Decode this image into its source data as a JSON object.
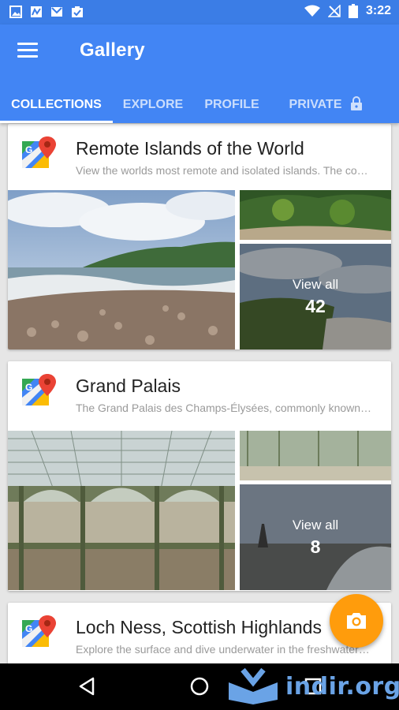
{
  "status_bar": {
    "time": "3:22",
    "left_icons": [
      "image-icon",
      "newsstand-icon",
      "gmail-icon",
      "task-icon"
    ],
    "right_icons": [
      "wifi-icon",
      "no-signal-icon",
      "battery-icon"
    ]
  },
  "app_bar": {
    "title": "Gallery",
    "menu_icon": "hamburger-menu-icon",
    "tabs": [
      {
        "label": "COLLECTIONS",
        "active": true
      },
      {
        "label": "EXPLORE",
        "active": false
      },
      {
        "label": "PROFILE",
        "active": false
      },
      {
        "label": "PRIVATE",
        "active": false,
        "icon": "lock-icon"
      }
    ]
  },
  "collections": [
    {
      "title": "Remote Islands of the World",
      "description": "View the worlds most remote and isolated islands. The co…",
      "view_all_label": "View all",
      "count": "42"
    },
    {
      "title": "Grand Palais",
      "description": "The Grand Palais des Champs-Élysées, commonly known…",
      "view_all_label": "View all",
      "count": "8"
    },
    {
      "title": "Loch Ness, Scottish Highlands",
      "description": "Explore the surface and dive underwater in the freshwater…"
    }
  ],
  "fab": {
    "icon": "camera-icon"
  },
  "nav_bar": {
    "buttons": [
      "back-icon",
      "home-icon",
      "recents-icon"
    ],
    "watermark": "indir.org"
  },
  "colors": {
    "status_bar": "#3b7de6",
    "app_bar": "#4285f4",
    "fab": "#ff9c0c",
    "background": "#e6e6e6"
  }
}
